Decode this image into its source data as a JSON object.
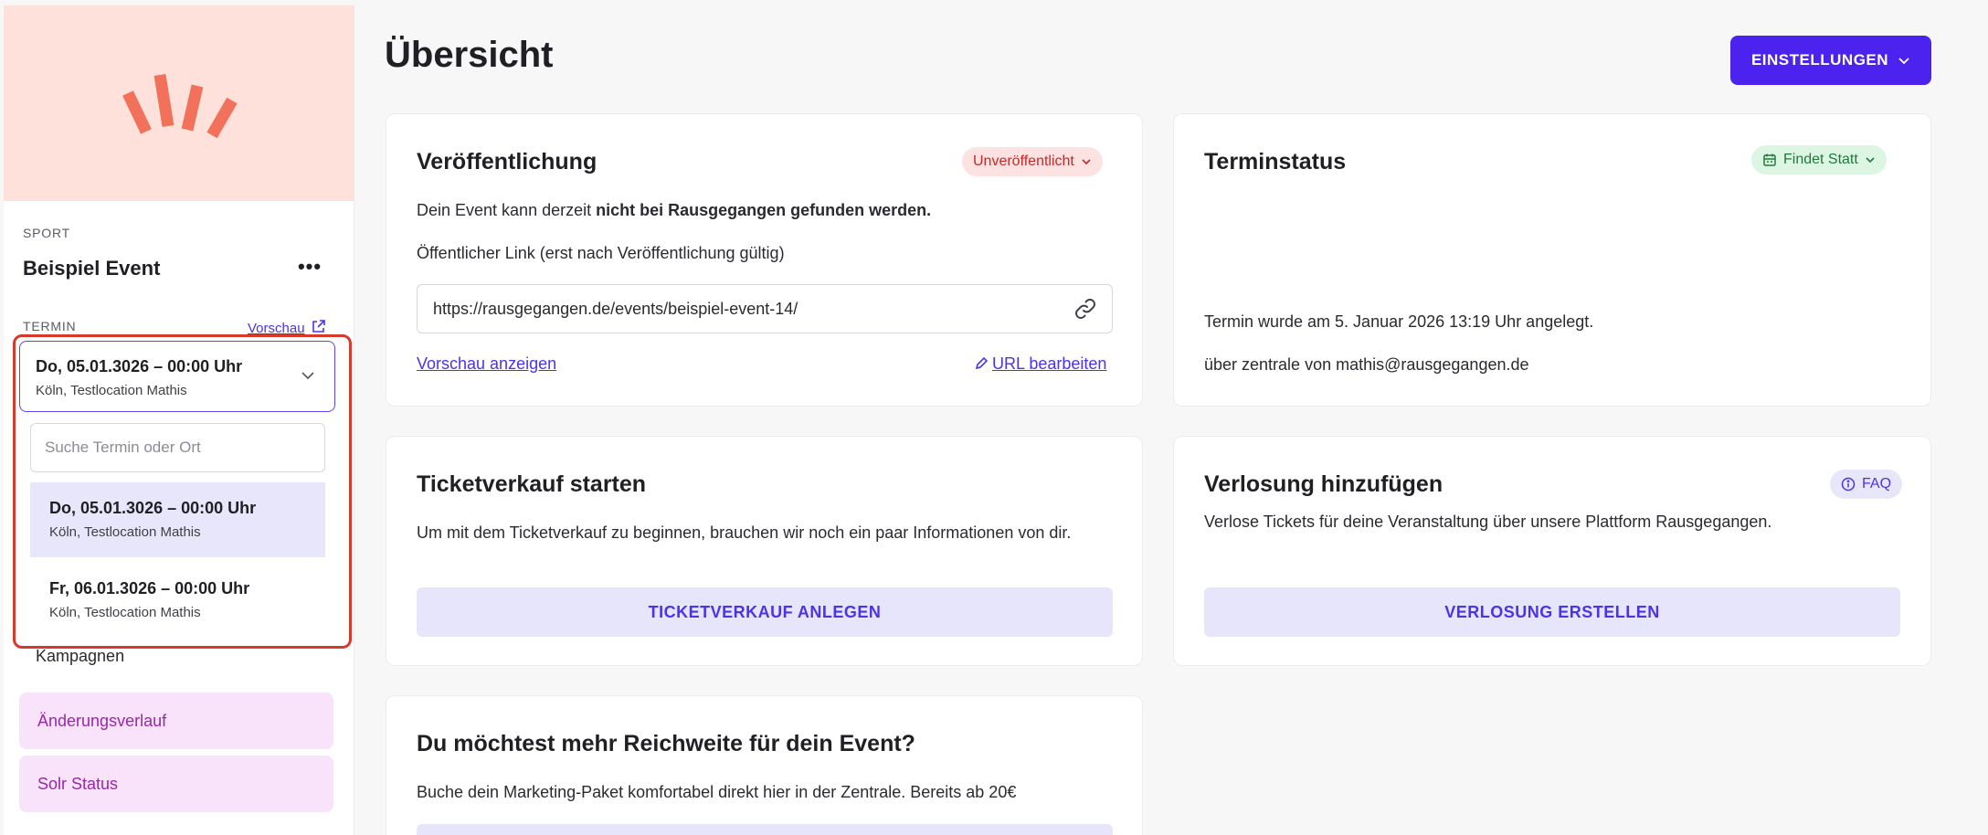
{
  "sidebar": {
    "category": "SPORT",
    "event_title": "Beispiel Event",
    "more_label": "•••",
    "termin_label": "TERMIN",
    "preview_link": "Vorschau",
    "selected": {
      "date": "Do, 05.01.3026 – 00:00 Uhr",
      "location": "Köln, Testlocation Mathis"
    },
    "search": {
      "placeholder": "Suche Termin oder Ort",
      "value": ""
    },
    "options": [
      {
        "date": "Do, 05.01.3026 – 00:00 Uhr",
        "location": "Köln, Testlocation Mathis"
      },
      {
        "date": "Fr, 06.01.3026 – 00:00 Uhr",
        "location": "Köln, Testlocation Mathis"
      }
    ],
    "kampagnen": "Kampagnen",
    "nav": [
      "Änderungsverlauf",
      "Solr Status"
    ]
  },
  "header": {
    "title": "Übersicht",
    "settings_label": "EINSTELLUNGEN"
  },
  "publication": {
    "title": "Veröffentlichung",
    "badge": "Unveröffentlicht",
    "text_prefix": "Dein Event kann derzeit ",
    "text_bold": "nicht bei Rausgegangen gefunden werden.",
    "link_label": "Öffentlicher Link (erst nach Veröffentlichung gültig)",
    "url": "https://rausgegangen.de/events/beispiel-event-14/",
    "preview_link": "Vorschau anzeigen",
    "edit_url": "URL bearbeiten"
  },
  "terminstatus": {
    "title": "Terminstatus",
    "badge": "Findet Statt",
    "created": "Termin wurde am 5. Januar 2026 13:19 Uhr angelegt.",
    "created_by": "über zentrale von mathis@rausgegangen.de"
  },
  "tickets": {
    "title": "Ticketverkauf starten",
    "text": "Um mit dem Ticketverkauf zu beginnen, brauchen wir noch ein paar Informationen von dir.",
    "button": "TICKETVERKAUF ANLEGEN"
  },
  "raffle": {
    "title": "Verlosung hinzufügen",
    "faq": "FAQ",
    "text": "Verlose Tickets für deine Veranstaltung über unsere Plattform Rausgegangen.",
    "button": "VERLOSUNG ERSTELLEN"
  },
  "marketing": {
    "title": "Du möchtest mehr Reichweite für dein Event?",
    "text": "Buche dein Marketing-Paket komfortabel direkt hier in der Zentrale. Bereits ab 20€"
  },
  "colors": {
    "accent": "#4b22ee",
    "hero_bg": "#fde1da",
    "logo": "#f2715a",
    "highlight": "#d8392d"
  }
}
